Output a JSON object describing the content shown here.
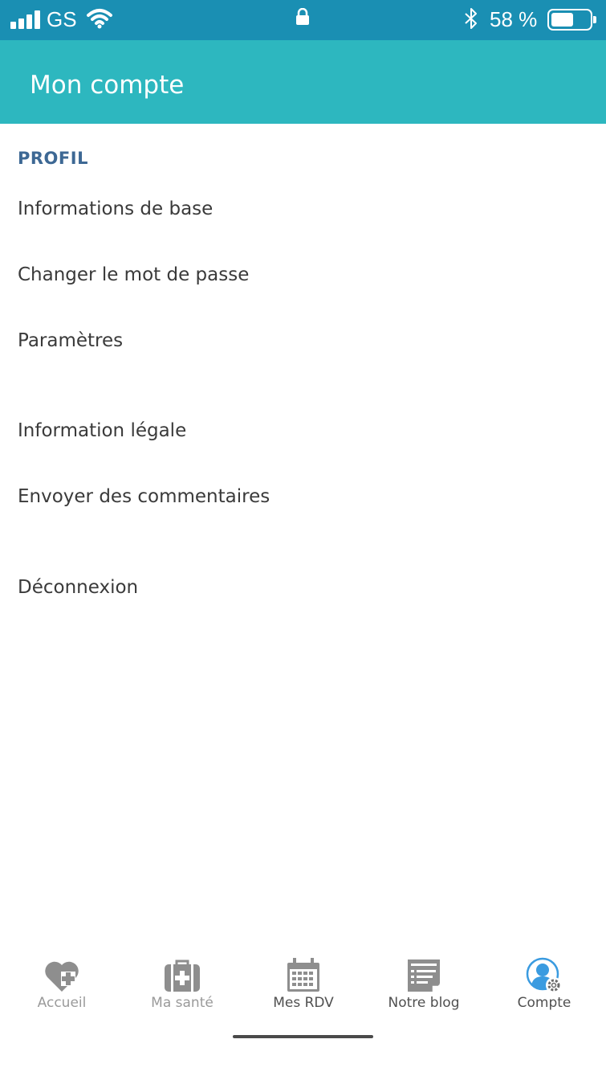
{
  "status_bar": {
    "carrier": "GS",
    "battery_percent": "58 %",
    "battery_level": 0.58,
    "icons": [
      "signal-icon",
      "wifi-icon",
      "lock-icon",
      "bluetooth-icon",
      "battery-icon"
    ]
  },
  "header": {
    "title": "Mon compte",
    "background_color": "#2db7bf"
  },
  "profile_section": {
    "label": "PROFIL",
    "label_color": "#3d6894"
  },
  "menu": {
    "basic_info": "Informations de base",
    "change_password": "Changer le mot de passe",
    "settings": "Paramètres",
    "legal": "Information légale",
    "feedback": "Envoyer des commentaires",
    "logout": "Déconnexion"
  },
  "tab_bar": {
    "tabs": [
      {
        "label": "Accueil",
        "icon": "heart-plus-icon"
      },
      {
        "label": "Ma santé",
        "icon": "medical-kit-icon"
      },
      {
        "label": "Mes RDV",
        "icon": "calendar-icon"
      },
      {
        "label": "Notre blog",
        "icon": "blog-icon"
      },
      {
        "label": "Compte",
        "icon": "account-settings-icon"
      }
    ],
    "active_tab": "Compte",
    "active_color": "#3a9be0"
  }
}
